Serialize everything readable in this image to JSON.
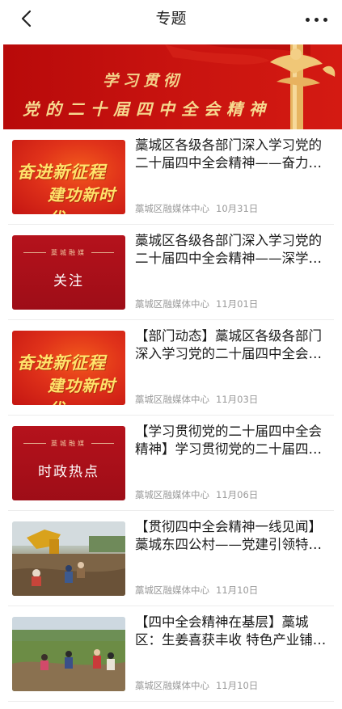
{
  "nav": {
    "title": "专题",
    "back_icon": "chevron-left-icon",
    "more_icon": "more-dots-icon"
  },
  "banner": {
    "line1": "学习贯彻",
    "line2": "党的二十届四中全会精神"
  },
  "articles": [
    {
      "title": "藁城区各级各部门深入学习党的二十届四中全会精神——奋力…",
      "source": "藁城区融媒体中心",
      "date": "10月31日",
      "thumb_line1": "奋进新征程",
      "thumb_line2": "建功新时代"
    },
    {
      "title": "藁城区各级各部门深入学习党的二十届四中全会精神——深学…",
      "source": "藁城区融媒体中心",
      "date": "11月01日",
      "thumb_tag": "藁城融媒",
      "thumb_text": "关注"
    },
    {
      "title": "【部门动态】藁城区各级各部门深入学习党的二十届四中全会…",
      "source": "藁城区融媒体中心",
      "date": "11月03日",
      "thumb_line1": "奋进新征程",
      "thumb_line2": "建功新时代"
    },
    {
      "title": "【学习贯彻党的二十届四中全会精神】学习贯彻党的二十届四…",
      "source": "藁城区融媒体中心",
      "date": "11月06日",
      "thumb_tag": "藁城融媒",
      "thumb_text": "时政热点"
    },
    {
      "title": "【贯彻四中全会精神一线见闻】藁城东四公村——党建引领特…",
      "source": "藁城区融媒体中心",
      "date": "11月10日"
    },
    {
      "title": "【四中全会精神在基层】藁城区：生姜喜获丰收 特色产业铺就…",
      "source": "藁城区融媒体中心",
      "date": "11月10日"
    }
  ]
}
